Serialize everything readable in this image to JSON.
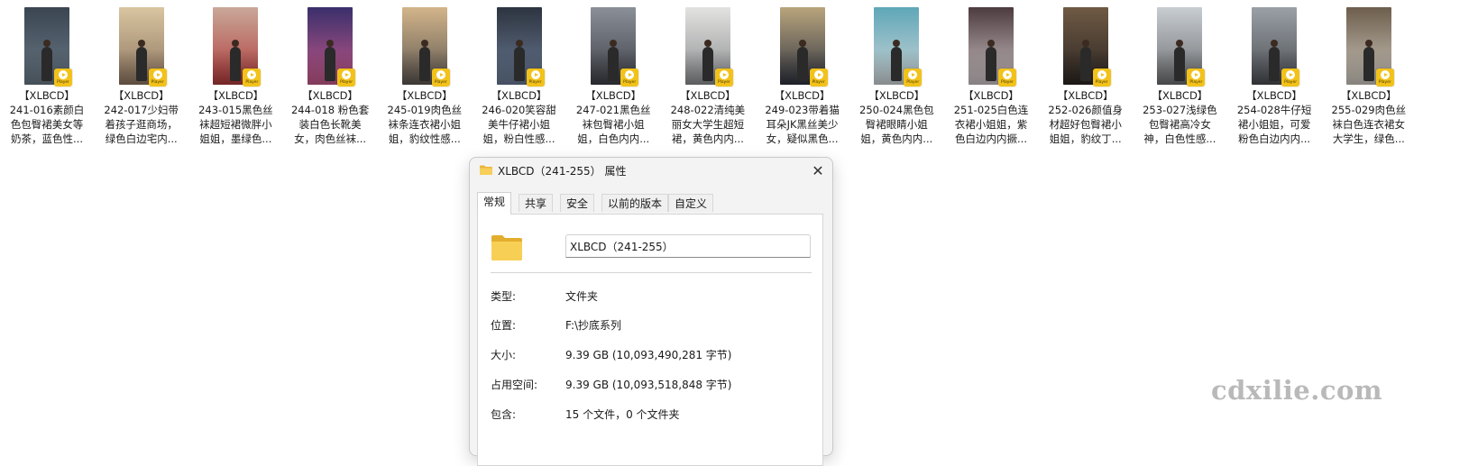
{
  "files": [
    {
      "line1": "【XLBCD】",
      "line2": "241-016素颜白",
      "line3": "色包臀裙美女等",
      "line4": "奶茶，蓝色性...",
      "thumb_top": "#3b4552",
      "thumb_bottom": "#6a7a86"
    },
    {
      "line1": "【XLBCD】",
      "line2": "242-017少妇带",
      "line3": "着孩子逛商场，",
      "line4": "绿色白边宅内...",
      "thumb_top": "#d9c5a0",
      "thumb_bottom": "#8d7560"
    },
    {
      "line1": "【XLBCD】",
      "line2": "243-015黑色丝",
      "line3": "袜超短裙微胖小",
      "line4": "姐姐，墨绿色...",
      "thumb_top": "#c9a899",
      "thumb_bottom": "#b03a3a"
    },
    {
      "line1": "【XLBCD】",
      "line2": "244-018 粉色套",
      "line3": "装白色长靴美",
      "line4": "女，肉色丝袜...",
      "thumb_top": "#3a2f6b",
      "thumb_bottom": "#c65a8a"
    },
    {
      "line1": "【XLBCD】",
      "line2": "245-019肉色丝",
      "line3": "袜条连衣裙小姐",
      "line4": "姐，豹纹性感...",
      "thumb_top": "#d3b58a",
      "thumb_bottom": "#5b5550"
    },
    {
      "line1": "【XLBCD】",
      "line2": "246-020笑容甜",
      "line3": "美牛仔裙小姐",
      "line4": "姐，粉白性感...",
      "thumb_top": "#2d3440",
      "thumb_bottom": "#6b7b95"
    },
    {
      "line1": "【XLBCD】",
      "line2": "247-021黑色丝",
      "line3": "袜包臀裙小姐",
      "line4": "姐，白色内内...",
      "thumb_top": "#8a8f98",
      "thumb_bottom": "#3d3f46"
    },
    {
      "line1": "【XLBCD】",
      "line2": "248-022清纯美",
      "line3": "丽女大学生超短",
      "line4": "裙，黄色内内...",
      "thumb_top": "#e3e3e0",
      "thumb_bottom": "#8b8d90"
    },
    {
      "line1": "【XLBCD】",
      "line2": "249-023带着猫",
      "line3": "耳朵JK黑丝美少",
      "line4": "女，疑似黑色...",
      "thumb_top": "#b9a57d",
      "thumb_bottom": "#2f3340"
    },
    {
      "line1": "【XLBCD】",
      "line2": "250-024黑色包",
      "line3": "臀裙眼睛小姐",
      "line4": "姐，黄色内内...",
      "thumb_top": "#5fa7b8",
      "thumb_bottom": "#cfd6d8"
    },
    {
      "line1": "【XLBCD】",
      "line2": "251-025白色连",
      "line3": "衣裙小姐姐，紫",
      "line4": "色白边内内撅...",
      "thumb_top": "#4c3b3f",
      "thumb_bottom": "#d0c6c8"
    },
    {
      "line1": "【XLBCD】",
      "line2": "252-026颜值身",
      "line3": "材超好包臀裙小",
      "line4": "姐姐，豹纹丁...",
      "thumb_top": "#6f5a44",
      "thumb_bottom": "#2b2522"
    },
    {
      "line1": "【XLBCD】",
      "line2": "253-027浅绿色",
      "line3": "包臀裙高冷女",
      "line4": "神，白色性感...",
      "thumb_top": "#c8cdd2",
      "thumb_bottom": "#6c6e70"
    },
    {
      "line1": "【XLBCD】",
      "line2": "254-028牛仔短",
      "line3": "裙小姐姐，可爱",
      "line4": "粉色白边内内...",
      "thumb_top": "#9aa0a6",
      "thumb_bottom": "#4a4d52"
    },
    {
      "line1": "【XLBCD】",
      "line2": "255-029肉色丝",
      "line3": "袜白色连衣裙女",
      "line4": "大学生，绿色...",
      "thumb_top": "#6d5e4c",
      "thumb_bottom": "#cfc9bf"
    }
  ],
  "badge": {
    "label": "Player",
    "color": "#f2c21b"
  },
  "dialog": {
    "title": "XLBCD（241-255） 属性",
    "close_glyph": "✕",
    "tabs": [
      "常规",
      "共享",
      "安全",
      "以前的版本",
      "自定义"
    ],
    "active_tab": "常规",
    "folder_name": "XLBCD（241-255）",
    "properties": [
      {
        "label": "类型:",
        "value": "文件夹"
      },
      {
        "label": "位置:",
        "value": "F:\\抄底系列"
      },
      {
        "label": "大小:",
        "value": "9.39 GB (10,093,490,281 字节)"
      },
      {
        "label": "占用空间:",
        "value": "9.39 GB (10,093,518,848 字节)"
      },
      {
        "label": "包含:",
        "value": "15 个文件，0 个文件夹"
      }
    ],
    "folder_color": "#f5c542"
  },
  "watermark": "cdxilie.com"
}
